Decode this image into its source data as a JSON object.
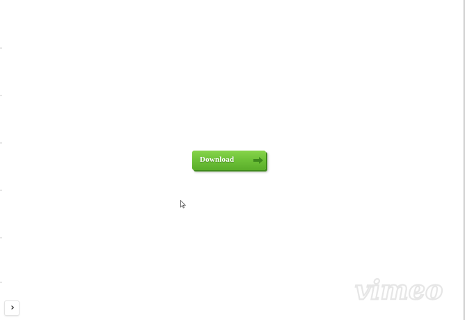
{
  "download_button": {
    "label": "Download",
    "icon": "arrow-right-icon",
    "color": "#6bbf36"
  },
  "watermark": {
    "text": "vimeo"
  },
  "expand_button": {
    "glyph": "›",
    "icon": "chevron-right-icon"
  },
  "cursor": {
    "icon": "mouse-pointer-icon"
  }
}
